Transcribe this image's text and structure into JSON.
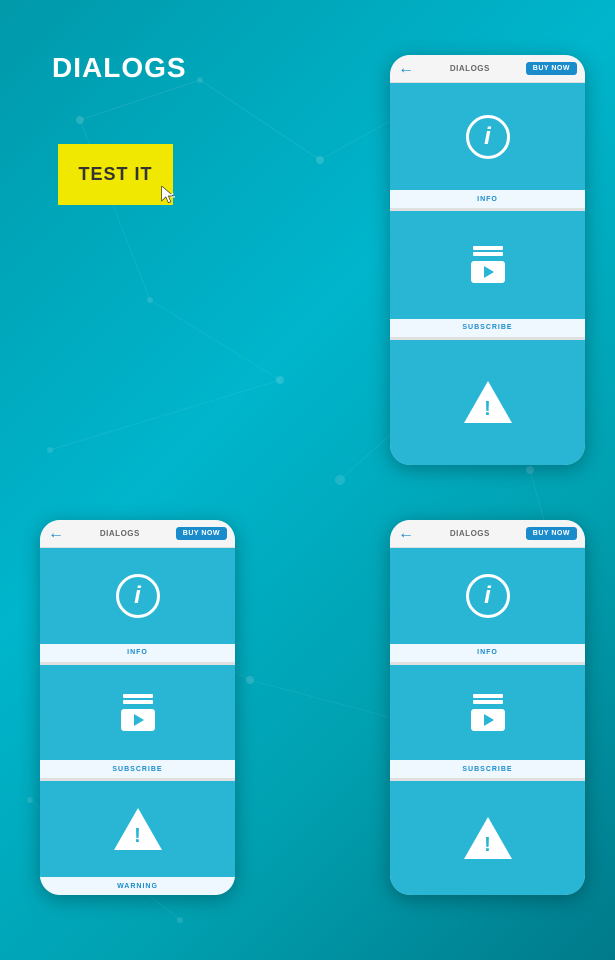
{
  "page": {
    "title": "DIALOGS",
    "background_color": "#00aabb"
  },
  "test_button": {
    "label": "TEST IT"
  },
  "phones": {
    "large": {
      "header": {
        "back_label": "←",
        "title": "DIALOGS",
        "buy_now": "BUY NOW"
      },
      "items": [
        {
          "icon": "info",
          "label": "INFO"
        },
        {
          "icon": "subscribe",
          "label": "SUBSCRIBE"
        },
        {
          "icon": "warning",
          "label": ""
        }
      ]
    },
    "bottom_left": {
      "header": {
        "back_label": "←",
        "title": "DIALOGS",
        "buy_now": "BUY NOW"
      },
      "items": [
        {
          "icon": "info",
          "label": "INFO"
        },
        {
          "icon": "subscribe",
          "label": "SUBSCRIBE"
        },
        {
          "icon": "warning",
          "label": "WARNING"
        }
      ]
    },
    "bottom_right": {
      "header": {
        "back_label": "←",
        "title": "DIALOGS",
        "buy_now": "BUY NOW"
      },
      "items": [
        {
          "icon": "info",
          "label": "INFO"
        },
        {
          "icon": "subscribe",
          "label": "SUBSCRIBE"
        },
        {
          "icon": "warning",
          "label": ""
        }
      ]
    }
  }
}
